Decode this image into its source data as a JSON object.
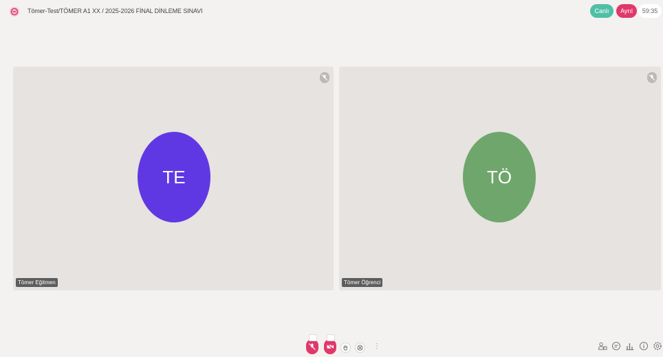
{
  "header": {
    "title": "Tömer-Test/TÖMER A1 XX / 2025-2026 FİNAL DİNLEME SINAVI",
    "live_label": "Canlı",
    "rec_label": "Ayrıl",
    "timer": "59:35"
  },
  "tiles": [
    {
      "initials": "TE",
      "name": "Tömer Eğitmen",
      "avatar_color": "#6038e3"
    },
    {
      "initials": "TÖ",
      "name": "Tömer Öğrenci",
      "avatar_color": "#6fa66c"
    }
  ],
  "toolbar": {
    "more_label": "⋮"
  },
  "colors": {
    "accent_red": "#e0386a",
    "accent_green": "#4fc0a5"
  },
  "icons": [
    "logo-icon",
    "mic-muted-icon",
    "mic-off-icon",
    "camera-off-icon",
    "raise-hand-icon",
    "screen-share-icon",
    "more-icon",
    "participants-icon",
    "chat-icon",
    "stats-icon",
    "info-icon",
    "settings-icon"
  ]
}
